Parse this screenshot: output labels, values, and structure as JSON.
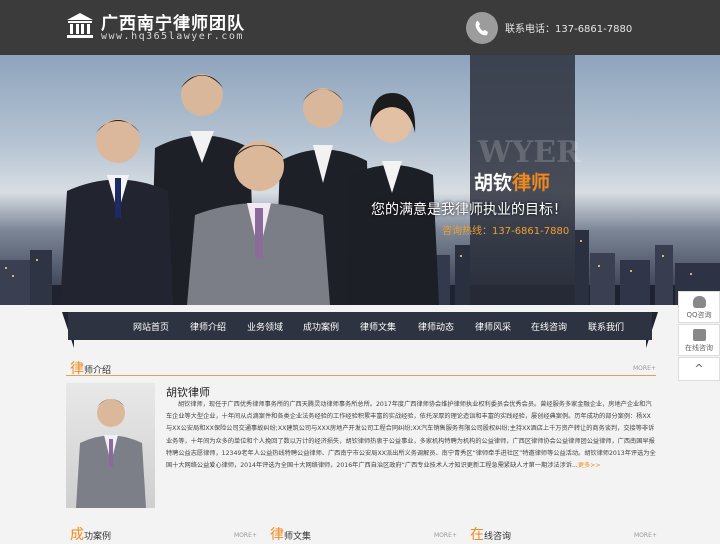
{
  "header": {
    "title": "广西南宁律师团队",
    "url": "www.hq365lawyer.com",
    "phone_label": "联系电话：137-6861-7880"
  },
  "banner": {
    "watermark": "WYER",
    "name_first": "胡钦",
    "name_accent": "律师",
    "slogan": "您的满意是我律师执业的目标！",
    "phone": "咨询热线：137-6861-7880"
  },
  "nav": {
    "items": [
      "网站首页",
      "律师介绍",
      "业务领域",
      "成功案例",
      "律师文集",
      "律师动态",
      "律师风采",
      "在线咨询",
      "联系我们"
    ]
  },
  "sidetools": {
    "qq": "QQ咨询",
    "online": "在线咨询",
    "up": "^"
  },
  "intro": {
    "head_big": "律",
    "head_rest": "师介绍",
    "more": "MORE+",
    "name": "胡钦律师",
    "body": "胡钦律师，现任于广西优秀律师事务所的广西天腾灵动律师事务所总所。2017年度广西律师协会维护律师执业权利委员会优秀会员。曾经服务多家金融企业，房地产企业和汽车企业等大型企业，十年间从点滴案件和各类企业法务经验的工作经验积累丰富的实战经验，依托深厚的理论造诣和丰富的实践经验，屡创经典案例。历年成功的部分案例：杨XX与XX公安局和XX保险公司交通事故纠纷;XX建筑公司与XXX房地产开发公司工程合同纠纷;XX汽车销售服务有限公司股权纠纷;主持XX酒店上千万资产转让的商务谈判，交接等非诉业务等，十年间为众多的单位和个人挽回了数以万计的经济损失，胡钦律师热衷于公益事业，多家机构特聘为机构的公益律师，广西区律师协会公益律师团公益律师，广西南国早报特聘公益志愿律师，12349老年人公益热线特聘公益律师、广西南宁市公安局XX派出所义务调解员、南宁青秀区“律师牵手进社区”特邀律师等公益活动。胡钦律师2013年评选为全国十大网络公益爱心律师，2014年评选为全国十大网络律师，2016年广西自治区政府“广西专业技术人才知识更新工程急需紧缺人才第一期涉法涉诉...",
    "more_link": "更多>>"
  },
  "bottom": {
    "cases_big": "成",
    "cases_rest": "功案例",
    "articles_big": "律",
    "articles_rest": "师文集",
    "consult_big": "在",
    "consult_rest": "线咨询",
    "more": "MORE+"
  }
}
